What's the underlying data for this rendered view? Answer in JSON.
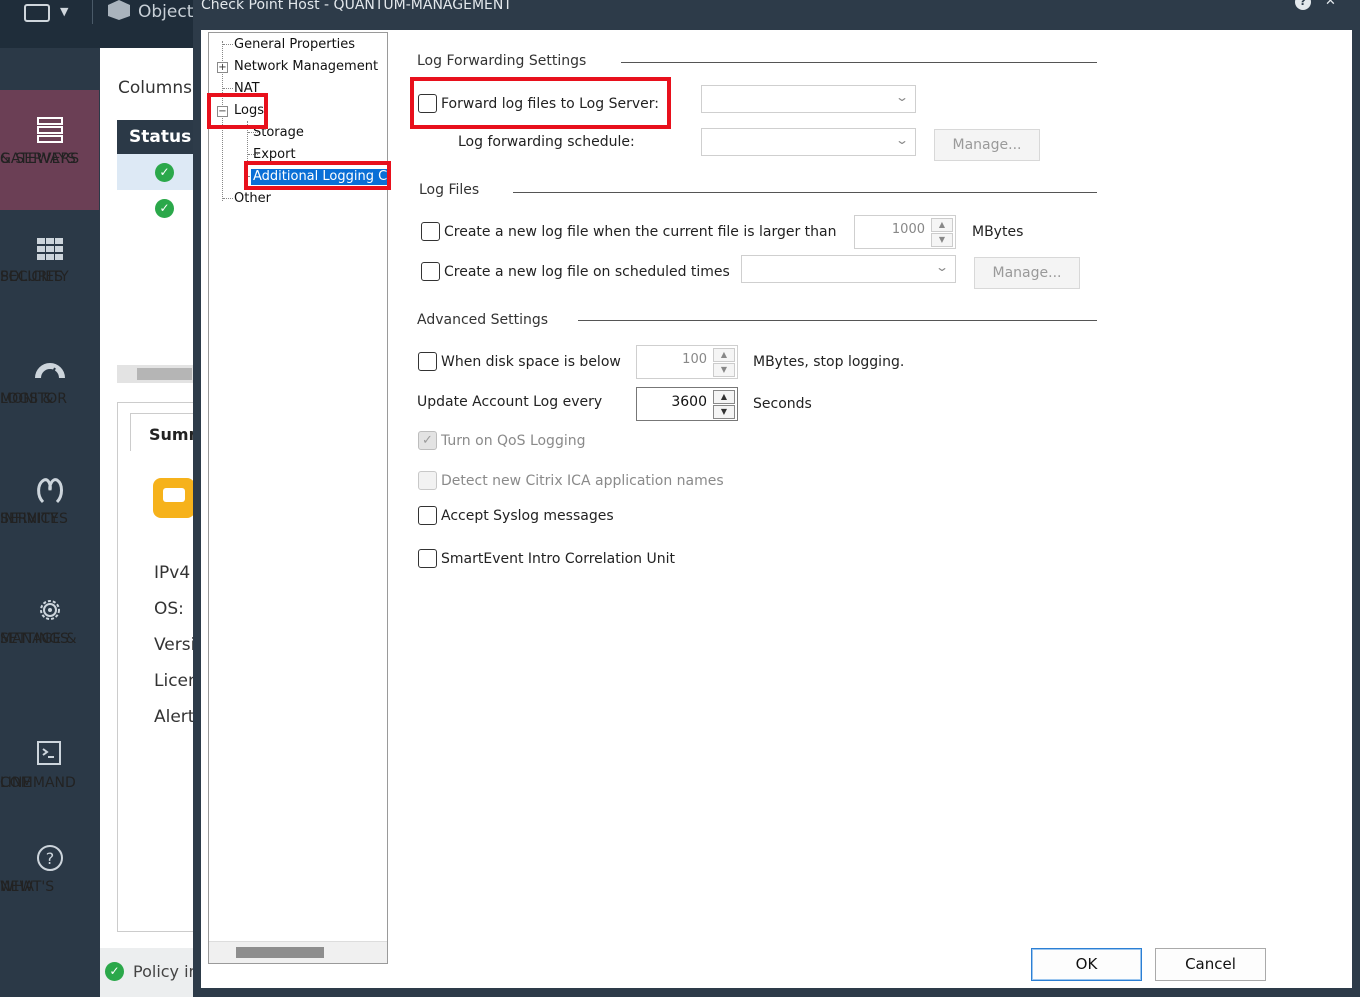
{
  "topbar": {
    "objects_label": "Objects"
  },
  "nav": [
    {
      "label1": "GATEWAYS",
      "label2": "& SERVERS",
      "icon": "gateways-servers-icon",
      "active": true
    },
    {
      "label1": "SECURITY",
      "label2": "POLICIES",
      "icon": "security-policies-icon"
    },
    {
      "label1": "LOGS &",
      "label2": "MONITOR",
      "icon": "logs-monitor-icon"
    },
    {
      "label1": "INFINITY",
      "label2": "SERVICES",
      "icon": "infinity-services-icon"
    },
    {
      "label1": "MANAGE &",
      "label2": "SETTINGS",
      "icon": "gear-icon"
    },
    {
      "label1": "COMMAND",
      "label2": "LINE",
      "icon": "command-line-icon"
    },
    {
      "label1": "WHAT'S",
      "label2": "NEW",
      "icon": "help-icon"
    }
  ],
  "background": {
    "columns_label": "Columns:",
    "status_header": "Status",
    "summary_tab": "Summ",
    "props": [
      "IPv4",
      "OS:",
      "Versi",
      "Licen",
      "Alert"
    ],
    "footer_policy": "Policy in"
  },
  "dialog": {
    "title": "Check Point Host - QUANTUM-MANAGEMENT",
    "tree": {
      "items": [
        "General Properties",
        "Network Management",
        "NAT",
        "Logs",
        "Storage",
        "Export",
        "Additional Logging Co",
        "Other"
      ],
      "expand_plus": "+",
      "collapse_minus": "−"
    },
    "log_forwarding": {
      "section": "Log Forwarding Settings",
      "forward_label": "Forward log files to Log Server:",
      "schedule_label": "Log forwarding schedule:",
      "manage_label": "Manage..."
    },
    "log_files": {
      "section": "Log Files",
      "larger_than_label": "Create a new log file when the current file is larger than",
      "larger_than_value": "1000",
      "larger_than_unit": "MBytes",
      "scheduled_label": "Create a new log file on scheduled times",
      "manage_label": "Manage..."
    },
    "advanced": {
      "section": "Advanced Settings",
      "disk_label": "When disk space is below",
      "disk_value": "100",
      "disk_unit": "MBytes, stop logging.",
      "account_label": "Update Account Log every",
      "account_value": "3600",
      "account_unit": "Seconds",
      "qos_label": "Turn on QoS Logging",
      "citrix_label": "Detect new Citrix ICA application names",
      "syslog_label": "Accept Syslog messages",
      "smartevent_label": "SmartEvent Intro Correlation Unit"
    },
    "buttons": {
      "ok": "OK",
      "cancel": "Cancel"
    }
  },
  "colors": {
    "highlight": "#e8101c",
    "selection": "#0a6fd6",
    "nav_active": "#6b3f55",
    "ok_green": "#2ba84a"
  }
}
